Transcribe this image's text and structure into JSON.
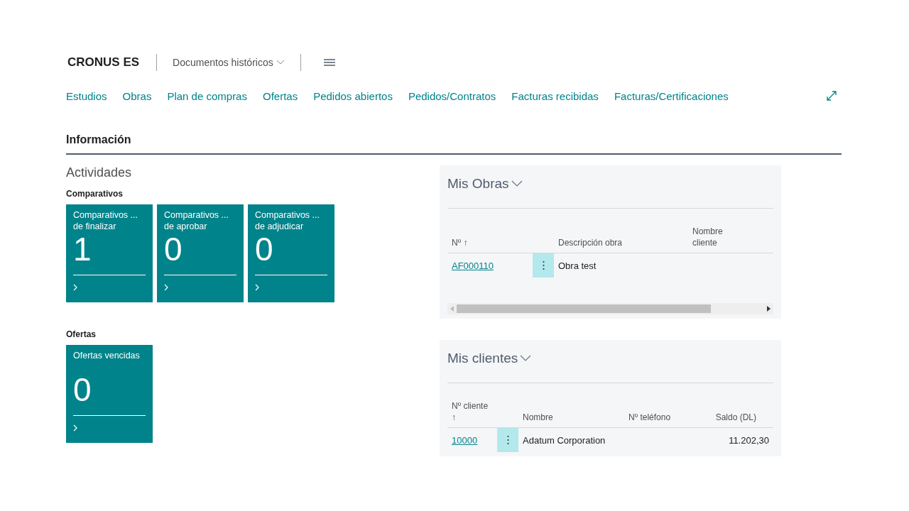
{
  "header": {
    "company": "CRONUS ES",
    "menu": "Documentos históricos"
  },
  "nav": [
    "Estudios",
    "Obras",
    "Plan de compras",
    "Ofertas",
    "Pedidos abiertos",
    "Pedidos/Contratos",
    "Facturas recibidas",
    "Facturas/Certificaciones"
  ],
  "section_title": "Información",
  "activities": {
    "title": "Actividades",
    "groups": [
      {
        "title": "Comparativos",
        "tiles": [
          {
            "label": "Comparativos ... de finalizar",
            "value": "1"
          },
          {
            "label": "Comparativos ... de aprobar",
            "value": "0"
          },
          {
            "label": "Comparativos ... de adjudicar",
            "value": "0"
          }
        ]
      },
      {
        "title": "Ofertas",
        "tiles": [
          {
            "label": "Ofertas vencidas",
            "value": "0"
          }
        ]
      }
    ]
  },
  "parts": [
    {
      "title": "Mis Obras",
      "columns": [
        {
          "label": "Nº ↑",
          "kind": "text"
        },
        {
          "label": "Descripción obra",
          "kind": "text"
        },
        {
          "label": "Nombre cliente",
          "kind": "text"
        }
      ],
      "rows": [
        [
          "AF000110",
          "Obra test",
          ""
        ]
      ],
      "scrollbar": true
    },
    {
      "title": "Mis clientes",
      "columns": [
        {
          "label": "Nº cliente ↑",
          "kind": "text"
        },
        {
          "label": "Nombre",
          "kind": "text"
        },
        {
          "label": "Nº teléfono",
          "kind": "text"
        },
        {
          "label": "Saldo (DL)",
          "kind": "amount"
        }
      ],
      "rows": [
        [
          "10000",
          "Adatum Corporation",
          "",
          "11.202,30"
        ]
      ],
      "scrollbar": false
    }
  ]
}
